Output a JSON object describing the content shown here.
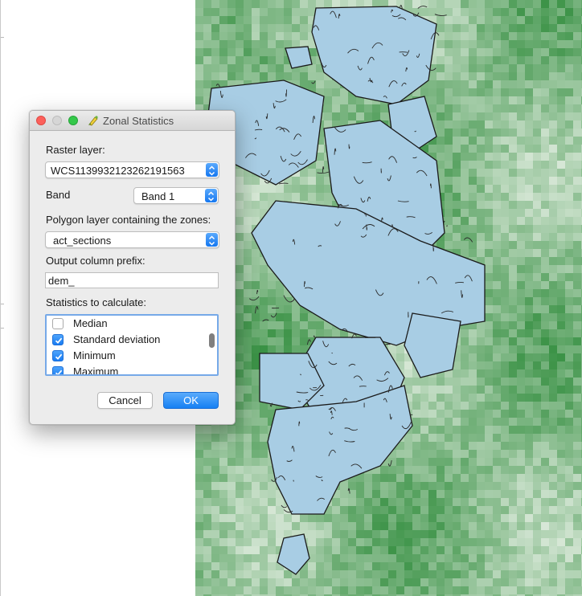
{
  "dialog": {
    "title": "Zonal Statistics",
    "raster_label": "Raster layer:",
    "raster_value": "WCS1139932123262191563",
    "band_label": "Band",
    "band_value": "Band 1",
    "polygon_label": "Polygon layer containing the zones:",
    "polygon_value": "act_sections",
    "prefix_label": "Output column prefix:",
    "prefix_value": "dem_",
    "stats_label": "Statistics to calculate:",
    "stats": [
      {
        "label": "Median",
        "checked": false
      },
      {
        "label": "Standard deviation",
        "checked": true
      },
      {
        "label": "Minimum",
        "checked": true
      },
      {
        "label": "Maximum",
        "checked": true
      }
    ],
    "cancel_label": "Cancel",
    "ok_label": "OK"
  },
  "colors": {
    "accent": "#1a7cf3",
    "polygon_fill": "#a8cde4",
    "raster_green": "#2e8b3a",
    "raster_light": "#eef4ec"
  },
  "icons": {
    "title": "qgis-zonal-statistics-icon",
    "popup": "chevron-updown-icon",
    "check": "checkmark-icon"
  }
}
